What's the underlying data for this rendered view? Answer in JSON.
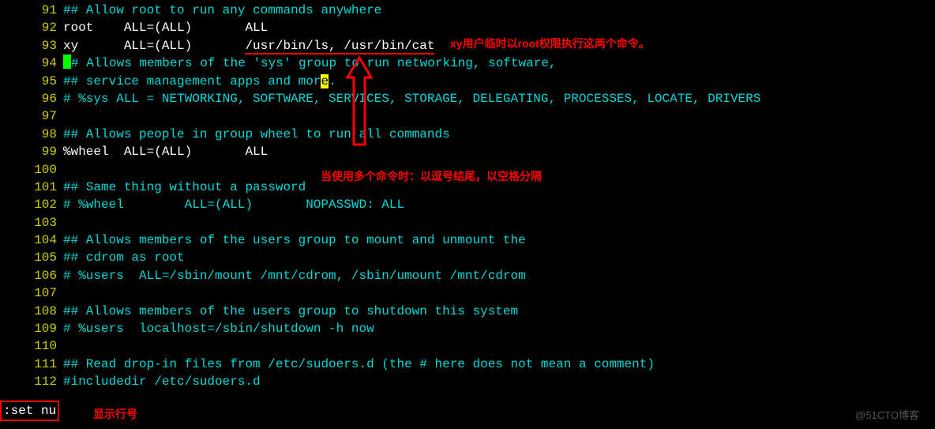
{
  "lines": [
    {
      "no": "91",
      "segs": [
        {
          "t": "## Allow root to run any commands anywhere",
          "c": "cyan"
        }
      ]
    },
    {
      "no": "92",
      "segs": [
        {
          "t": "root    ALL=(ALL)       ALL",
          "c": "white"
        }
      ]
    },
    {
      "no": "93",
      "segs": [
        {
          "t": "xy      ALL=(ALL)       ",
          "c": "white"
        },
        {
          "t": "/usr/bin/ls, /usr/bin/cat",
          "c": "white",
          "u": true
        }
      ]
    },
    {
      "no": "94",
      "segs": [
        {
          "t": " ",
          "c": "green-hl"
        },
        {
          "t": "# Allows members of the 'sys' group to run networking, software,",
          "c": "cyan"
        }
      ]
    },
    {
      "no": "95",
      "segs": [
        {
          "t": "## service management apps and mor",
          "c": "cyan"
        },
        {
          "t": "e",
          "c": "cyan",
          "hy": true
        },
        {
          "t": ".",
          "c": "cyan"
        }
      ]
    },
    {
      "no": "96",
      "segs": [
        {
          "t": "# %sys ALL = NETWORKING, SOFTWARE, SERVICES, STORAGE, DELEGATING, PROCESSES, LOCATE, DRIVERS",
          "c": "cyan"
        }
      ]
    },
    {
      "no": "97",
      "segs": [
        {
          "t": "",
          "c": "white"
        }
      ]
    },
    {
      "no": "98",
      "segs": [
        {
          "t": "## Allows people in group wheel to run all commands",
          "c": "cyan"
        }
      ]
    },
    {
      "no": "99",
      "segs": [
        {
          "t": "%wheel  ALL=(ALL)       ALL",
          "c": "white"
        }
      ]
    },
    {
      "no": "100",
      "segs": [
        {
          "t": "",
          "c": "white"
        }
      ]
    },
    {
      "no": "101",
      "segs": [
        {
          "t": "## Same thing without a password",
          "c": "cyan"
        }
      ]
    },
    {
      "no": "102",
      "segs": [
        {
          "t": "# %wheel        ALL=(ALL)       NOPASSWD: ALL",
          "c": "cyan"
        }
      ]
    },
    {
      "no": "103",
      "segs": [
        {
          "t": "",
          "c": "white"
        }
      ]
    },
    {
      "no": "104",
      "segs": [
        {
          "t": "## Allows members of the users group to mount and unmount the ",
          "c": "cyan"
        }
      ]
    },
    {
      "no": "105",
      "segs": [
        {
          "t": "## cdrom as root",
          "c": "cyan"
        }
      ]
    },
    {
      "no": "106",
      "segs": [
        {
          "t": "# %users  ALL=/sbin/mount /mnt/cdrom, /sbin/umount /mnt/cdrom",
          "c": "cyan"
        }
      ]
    },
    {
      "no": "107",
      "segs": [
        {
          "t": "",
          "c": "white"
        }
      ]
    },
    {
      "no": "108",
      "segs": [
        {
          "t": "## Allows members of the users group to shutdown this system",
          "c": "cyan"
        }
      ]
    },
    {
      "no": "109",
      "segs": [
        {
          "t": "# %users  localhost=/sbin/shutdown -h now",
          "c": "cyan"
        }
      ]
    },
    {
      "no": "110",
      "segs": [
        {
          "t": "",
          "c": "white"
        }
      ]
    },
    {
      "no": "111",
      "segs": [
        {
          "t": "## Read drop-in files from /etc/sudoers.d (the # here does not mean a comment)",
          "c": "cyan"
        }
      ]
    },
    {
      "no": "112",
      "segs": [
        {
          "t": "#includedir /etc/sudoers.d",
          "c": "cyan"
        }
      ]
    }
  ],
  "cmd": ":set nu",
  "annotations": {
    "a1": "xy用户临时以root权限执行这两个命令。",
    "a2": "当使用多个命令时：以逗号结尾，以空格分隔",
    "a3": "显示行号"
  },
  "watermark": "@51CTO博客"
}
